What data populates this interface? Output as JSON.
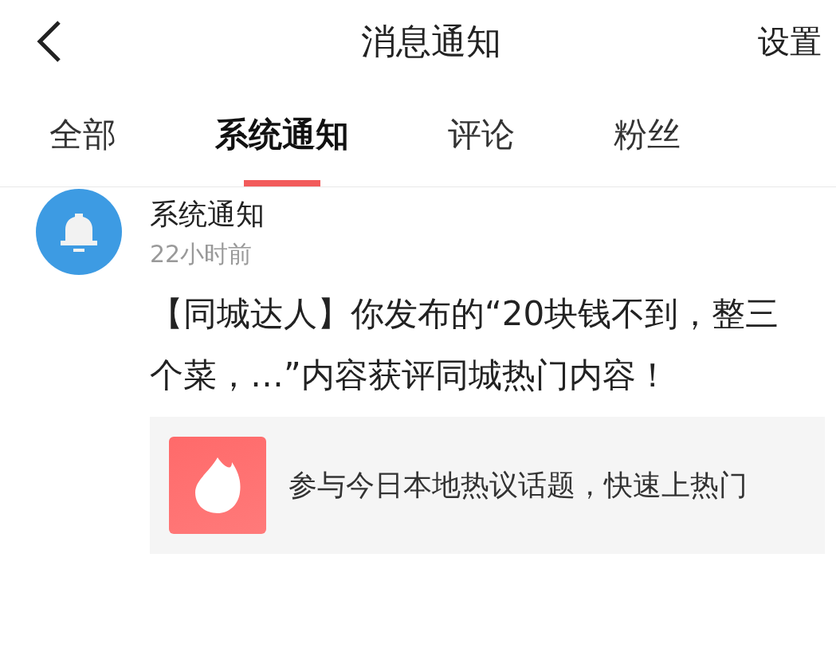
{
  "header": {
    "title": "消息通知",
    "action": "设置"
  },
  "tabs": [
    {
      "label": "全部",
      "selected": false
    },
    {
      "label": "系统通知",
      "selected": true
    },
    {
      "label": "评论",
      "selected": false
    },
    {
      "label": "粉丝",
      "selected": false
    }
  ],
  "notifications": [
    {
      "sender": "系统通知",
      "time": "22小时前",
      "message": "【同城达人】你发布的“20块钱不到，整三个菜，…”内容获评同城热门内容！",
      "card": {
        "text": "参与今日本地热议话题，快速上热门"
      }
    }
  ]
}
